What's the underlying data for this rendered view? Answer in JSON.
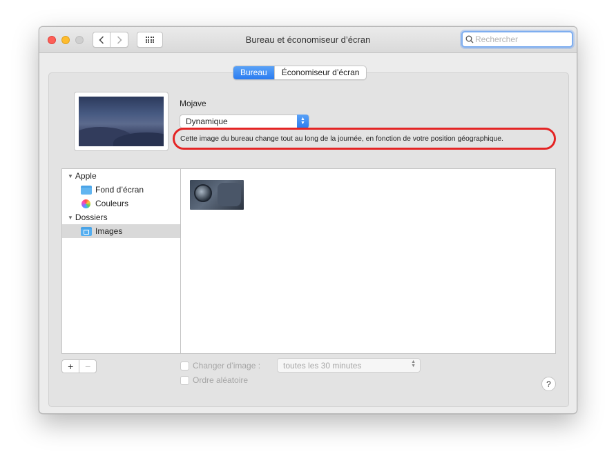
{
  "window": {
    "title": "Bureau et économiseur d’écran"
  },
  "search": {
    "placeholder": "Rechercher"
  },
  "tabs": [
    {
      "label": "Bureau",
      "active": true
    },
    {
      "label": "Économiseur d’écran",
      "active": false
    }
  ],
  "wallpaper": {
    "name": "Mojave",
    "mode_value": "Dynamique",
    "description": "Cette image du bureau change tout au long de la journée, en fonction de votre position géographique."
  },
  "sidebar": {
    "groups": [
      {
        "label": "Apple",
        "items": [
          {
            "label": "Fond d’écran",
            "icon": "folder-icon"
          },
          {
            "label": "Couleurs",
            "icon": "color-wheel-icon"
          }
        ]
      },
      {
        "label": "Dossiers",
        "items": [
          {
            "label": "Images",
            "icon": "images-folder-icon",
            "selected": true
          }
        ]
      }
    ]
  },
  "controls": {
    "add_label": "+",
    "remove_label": "−",
    "change_image_label": "Changer d’image :",
    "interval_value": "toutes les 30 minutes",
    "random_order_label": "Ordre aléatoire",
    "help_label": "?"
  },
  "colors": {
    "accent": "#2a7cf0",
    "highlight_ring": "#e42424"
  }
}
